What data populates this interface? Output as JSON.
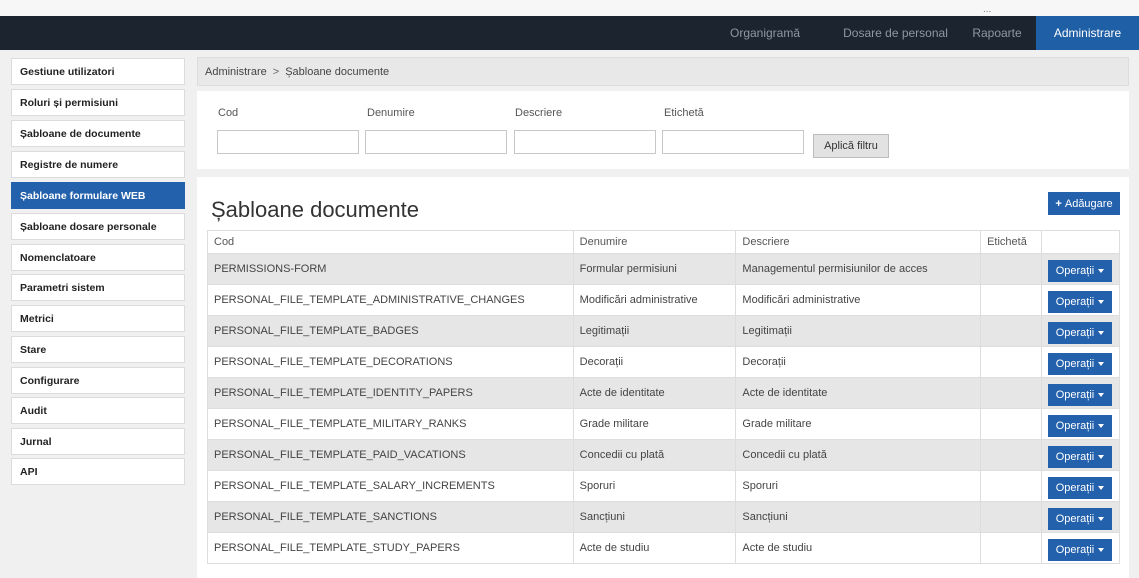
{
  "topbar": {
    "user": "..."
  },
  "nav": {
    "items": [
      {
        "label": "Organigramă",
        "active": false
      },
      {
        "label": "Dosare de personal",
        "active": false
      },
      {
        "label": "Rapoarte",
        "active": false
      },
      {
        "label": "Administrare",
        "active": true
      }
    ]
  },
  "sidebar": {
    "items": [
      {
        "label": "Gestiune utilizatori",
        "active": false
      },
      {
        "label": "Roluri și permisiuni",
        "active": false
      },
      {
        "label": "Șabloane de documente",
        "active": false
      },
      {
        "label": "Registre de numere",
        "active": false
      },
      {
        "label": "Șabloane formulare WEB",
        "active": true
      },
      {
        "label": "Șabloane dosare personale",
        "active": false
      },
      {
        "label": "Nomenclatoare",
        "active": false
      },
      {
        "label": "Parametri sistem",
        "active": false
      },
      {
        "label": "Metrici",
        "active": false
      },
      {
        "label": "Stare",
        "active": false
      },
      {
        "label": "Configurare",
        "active": false
      },
      {
        "label": "Audit",
        "active": false
      },
      {
        "label": "Jurnal",
        "active": false
      },
      {
        "label": "API",
        "active": false
      }
    ]
  },
  "breadcrumb": {
    "root": "Administrare",
    "separator": ">",
    "current": "Șabloane documente"
  },
  "filter": {
    "labels": {
      "cod": "Cod",
      "denumire": "Denumire",
      "descriere": "Descriere",
      "eticheta": "Etichetă"
    },
    "values": {
      "cod": "",
      "denumire": "",
      "descriere": "",
      "eticheta": ""
    },
    "apply_label": "Aplică filtru"
  },
  "main": {
    "title": "Șabloane documente",
    "add_label": "Adăugare",
    "columns": {
      "cod": "Cod",
      "denumire": "Denumire",
      "descriere": "Descriere",
      "eticheta": "Etichetă"
    },
    "operations_label": "Operații",
    "rows": [
      {
        "cod": "PERMISSIONS-FORM",
        "denumire": "Formular permisiuni",
        "descriere": "Managementul permisiunilor de acces",
        "eticheta": ""
      },
      {
        "cod": "PERSONAL_FILE_TEMPLATE_ADMINISTRATIVE_CHANGES",
        "denumire": "Modificări administrative",
        "descriere": "Modificări administrative",
        "eticheta": ""
      },
      {
        "cod": "PERSONAL_FILE_TEMPLATE_BADGES",
        "denumire": "Legitimații",
        "descriere": "Legitimații",
        "eticheta": ""
      },
      {
        "cod": "PERSONAL_FILE_TEMPLATE_DECORATIONS",
        "denumire": "Decorații",
        "descriere": "Decorații",
        "eticheta": ""
      },
      {
        "cod": "PERSONAL_FILE_TEMPLATE_IDENTITY_PAPERS",
        "denumire": "Acte de identitate",
        "descriere": "Acte de identitate",
        "eticheta": ""
      },
      {
        "cod": "PERSONAL_FILE_TEMPLATE_MILITARY_RANKS",
        "denumire": "Grade militare",
        "descriere": "Grade militare",
        "eticheta": ""
      },
      {
        "cod": "PERSONAL_FILE_TEMPLATE_PAID_VACATIONS",
        "denumire": "Concedii cu plată",
        "descriere": "Concedii cu plată",
        "eticheta": ""
      },
      {
        "cod": "PERSONAL_FILE_TEMPLATE_SALARY_INCREMENTS",
        "denumire": "Sporuri",
        "descriere": "Sporuri",
        "eticheta": ""
      },
      {
        "cod": "PERSONAL_FILE_TEMPLATE_SANCTIONS",
        "denumire": "Sancțiuni",
        "descriere": "Sancțiuni",
        "eticheta": ""
      },
      {
        "cod": "PERSONAL_FILE_TEMPLATE_STUDY_PAPERS",
        "denumire": "Acte de studiu",
        "descriere": "Acte de studiu",
        "eticheta": ""
      }
    ]
  },
  "colors": {
    "navbar": "#1c2430",
    "accent": "#2461ac",
    "stripe": "#e6e6e6"
  }
}
